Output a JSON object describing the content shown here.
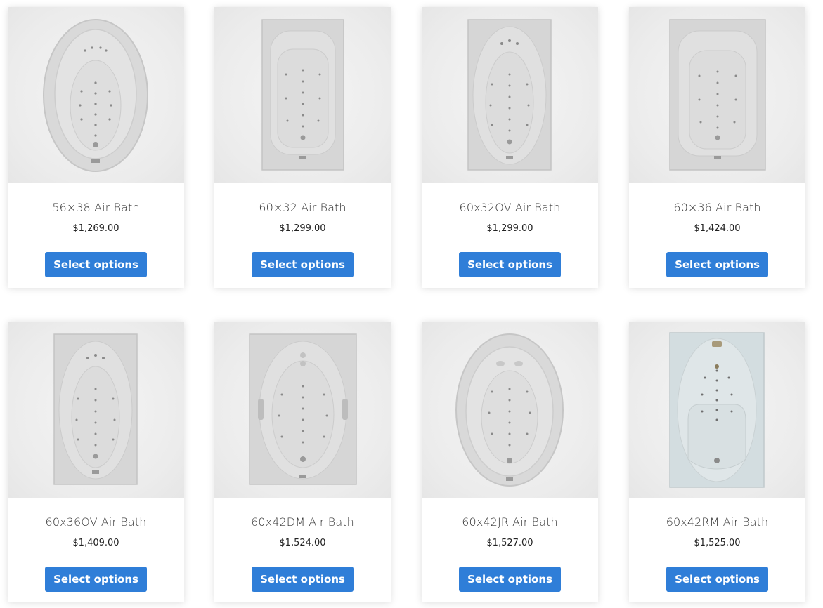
{
  "products": [
    {
      "title": "56×38 Air Bath",
      "price": "$1,269.00",
      "button": "Select options",
      "image": "oval-drop-in-tub"
    },
    {
      "title": "60×32 Air Bath",
      "price": "$1,299.00",
      "button": "Select options",
      "image": "rectangular-tub-armrests"
    },
    {
      "title": "60x32OV Air Bath",
      "price": "$1,299.00",
      "button": "Select options",
      "image": "rectangular-tub-oval-basin"
    },
    {
      "title": "60×36 Air Bath",
      "price": "$1,424.00",
      "button": "Select options",
      "image": "rectangular-tub-armrests"
    },
    {
      "title": "60x36OV Air Bath",
      "price": "$1,409.00",
      "button": "Select options",
      "image": "rectangular-tub-oval-basin"
    },
    {
      "title": "60x42DM Air Bath",
      "price": "$1,524.00",
      "button": "Select options",
      "image": "rectangular-tub-grab-bars"
    },
    {
      "title": "60x42JR Air Bath",
      "price": "$1,527.00",
      "button": "Select options",
      "image": "oval-drop-in-tub"
    },
    {
      "title": "60x42RM Air Bath",
      "price": "$1,525.00",
      "button": "Select options",
      "image": "rectangular-tub-lounger"
    }
  ],
  "colors": {
    "button": "#2f7ed8",
    "button_text": "#ffffff",
    "title": "#333333",
    "price": "#222222",
    "image_bg": "#ececec"
  }
}
